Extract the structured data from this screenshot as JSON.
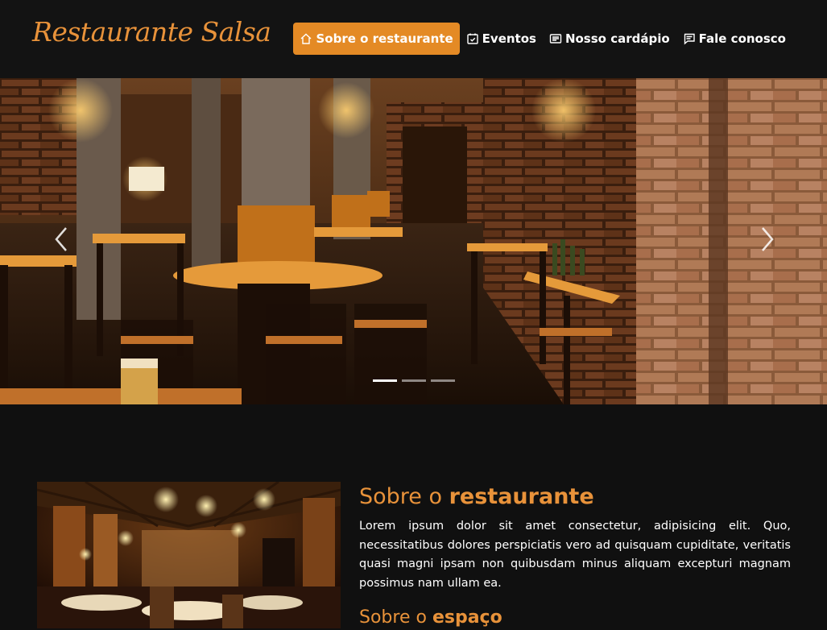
{
  "brand": {
    "logo_text": "Restaurante Salsa",
    "accent": "#e48a25"
  },
  "nav": {
    "items": [
      {
        "label": "Sobre o restaurante",
        "icon": "home-icon",
        "active": true
      },
      {
        "label": "Eventos",
        "icon": "calendar-check-icon",
        "active": false
      },
      {
        "label": "Nosso cardápio",
        "icon": "card-text-icon",
        "active": false
      },
      {
        "label": "Fale conosco",
        "icon": "chat-text-icon",
        "active": false
      }
    ]
  },
  "carousel": {
    "prev_icon": "chevron-left-icon",
    "next_icon": "chevron-right-icon",
    "slide_count": 3,
    "active_slide": 1
  },
  "about": {
    "title_normal": "Sobre o ",
    "title_bold": "restaurante",
    "body": "Lorem ipsum dolor sit amet consectetur, adipisicing elit. Quo, necessitatibus dolores perspiciatis vero ad quisquam cupiditate, veritatis quasi magni ipsam non quibusdam minus aliquam excepturi magnam possimus nam ullam ea.",
    "space_title_normal": "Sobre o ",
    "space_title_bold": "espaço"
  }
}
